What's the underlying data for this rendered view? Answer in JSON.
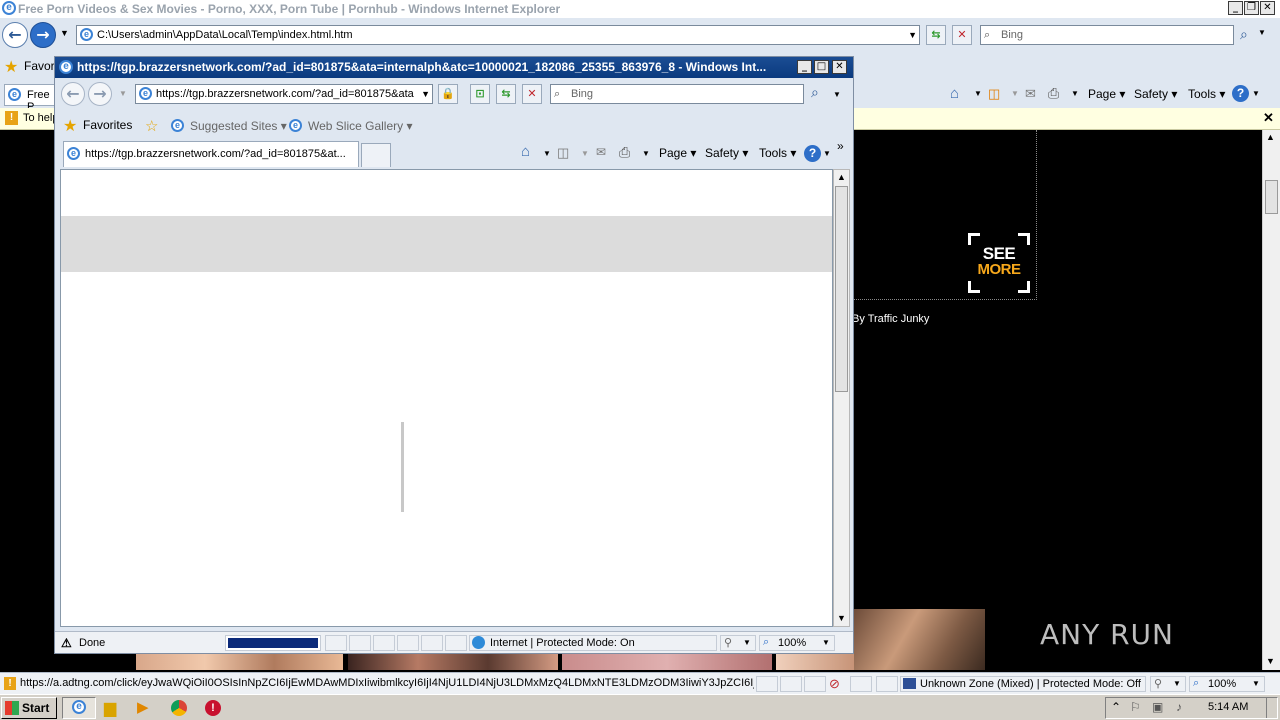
{
  "bg_window": {
    "title": "Free Porn Videos & Sex Movies - Porno, XXX, Porn Tube | Pornhub - Windows Internet Explorer",
    "address": "C:\\Users\\admin\\AppData\\Local\\Temp\\index.html.htm",
    "search_placeholder": "Bing",
    "favorites_label": "Favori",
    "tab_label": "Free P",
    "infobar_text": "To help",
    "cmd": {
      "page": "Page",
      "safety": "Safety",
      "tools": "Tools"
    },
    "ad": {
      "see": "SEE",
      "more": "MORE",
      "by_label": "By Traffic Junky"
    },
    "status": {
      "url": "https://a.adtng.com/click/eyJwaWQiOiI0OSIsInNpZCI6IjEwMDAwMDIxIiwibmlkcyI6IjI4NjU1LDI4NjU3LDMxMzQ4LDMxNTE3LDMzODM3IiwiY3JpZCI6Ijg2M",
      "zone": "Unknown Zone (Mixed) | Protected Mode: Off",
      "zoom": "100%"
    },
    "accent": "#f7a81b"
  },
  "popup": {
    "title": "https://tgp.brazzersnetwork.com/?ad_id=801875&ata=internalph&atc=10000021_182086_25355_863976_8 - Windows Int...",
    "address": "https://tgp.brazzersnetwork.com/?ad_id=801875&ata",
    "search_placeholder": "Bing",
    "favorites_label": "Favorites",
    "suggested_sites": "Suggested Sites",
    "web_slice_gallery": "Web Slice Gallery",
    "tab_label": "https://tgp.brazzersnetwork.com/?ad_id=801875&at...",
    "cmd": {
      "page": "Page",
      "safety": "Safety",
      "tools": "Tools"
    },
    "status": {
      "done": "Done",
      "zone": "Internet | Protected Mode: On",
      "zoom": "100%",
      "progress": 1.0
    }
  },
  "taskbar": {
    "start_label": "Start",
    "clock": "5:14 AM"
  },
  "watermark": "ANY RUN"
}
